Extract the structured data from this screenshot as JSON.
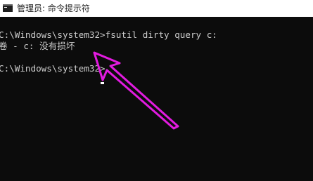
{
  "window": {
    "title": "管理员: 命令提示符",
    "app_icon": "cmd-console-icon"
  },
  "console": {
    "lines": [
      "C:\\Windows\\system32>fsutil dirty query c:",
      "卷 - c: 没有损坏",
      "",
      "C:\\Windows\\system32>"
    ]
  },
  "annotation": {
    "type": "arrow",
    "color": "#e21be0",
    "points_to": "command-prompt-cursor"
  }
}
